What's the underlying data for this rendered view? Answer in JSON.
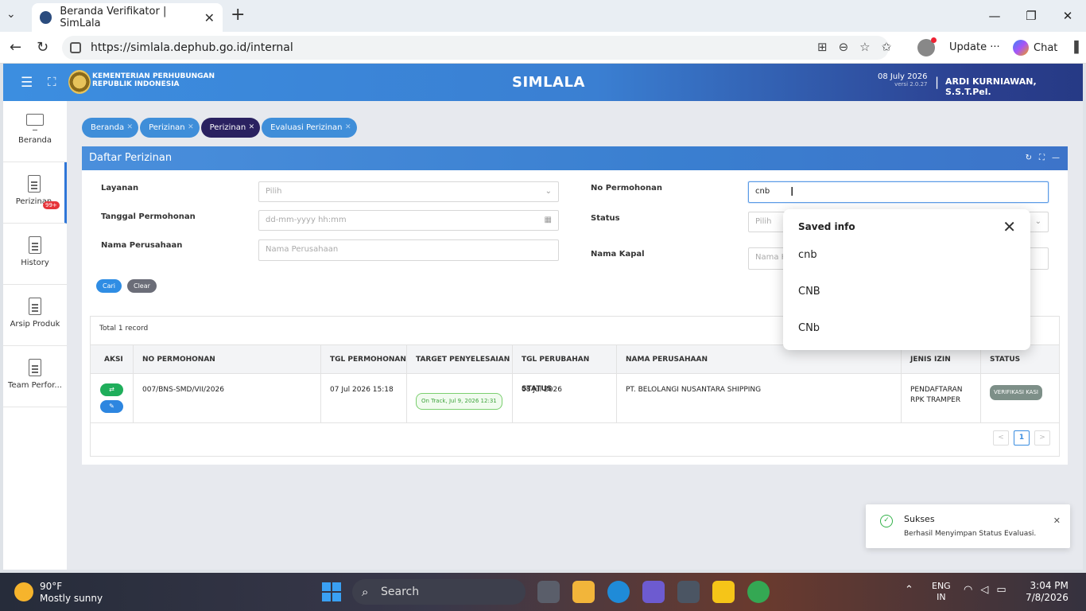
{
  "browser": {
    "tab_title": "Beranda Verifikator | SimLala",
    "url": "https://simlala.dephub.go.id/internal",
    "update_label": "Update",
    "chat_label": "Chat"
  },
  "header": {
    "ministry_line1": "KEMENTERIAN PERHUBUNGAN",
    "ministry_line2": "REPUBLIK INDONESIA",
    "app_title": "SIMLALA",
    "date": "08 July 2026",
    "version": "versi 2.0.27",
    "user": "ARDI KURNIAWAN, S.S.T.Pel."
  },
  "sidebar": {
    "items": [
      {
        "label": "Beranda"
      },
      {
        "label": "Perizinan",
        "badge": "99+"
      },
      {
        "label": "History"
      },
      {
        "label": "Arsip Produk"
      },
      {
        "label": "Team Perfor..."
      }
    ]
  },
  "crumbs": [
    "Beranda",
    "Perizinan",
    "Perizinan",
    "Evaluasi Perizinan"
  ],
  "panel": {
    "title": "Daftar Perizinan",
    "filters": {
      "layanan_label": "Layanan",
      "layanan_value": "Pilih",
      "tanggal_label": "Tanggal Permohonan",
      "tanggal_placeholder": "dd-mm-yyyy hh:mm",
      "nama_perusahaan_label": "Nama Perusahaan",
      "nama_perusahaan_placeholder": "Nama Perusahaan",
      "no_permohonan_label": "No Permohonan",
      "no_permohonan_value": "cnb",
      "status_label": "Status",
      "status_value": "Pilih",
      "nama_kapal_label": "Nama Kapal",
      "nama_kapal_placeholder": "Nama K"
    },
    "buttons": {
      "cari": "Cari",
      "clear": "Clear"
    }
  },
  "table": {
    "total": "Total 1 record",
    "headers": [
      "AKSI",
      "NO PERMOHONAN",
      "TGL PERMOHONAN",
      "TARGET PENYELESAIAN",
      "TGL PERUBAHAN STATUS",
      "NAMA PERUSAHAAN",
      "JENIS IZIN",
      "STATUS"
    ],
    "rows": [
      {
        "no_permohonan": "007/BNS-SMD/VII/2026",
        "tgl_permohonan": "07 Jul 2026 15:18",
        "target": "On Track, Jul 9, 2026 12:31",
        "tgl_perubahan": "08 Jul 2026",
        "nama_perusahaan": "PT. BELOLANGI NUSANTARA SHIPPING",
        "jenis_izin_1": "PENDAFTARAN",
        "jenis_izin_2": "RPK TRAMPER",
        "status": "VERIFIKASI KASI"
      }
    ],
    "page": "1"
  },
  "autofill": {
    "title": "Saved info",
    "items": [
      "cnb",
      "CNB",
      "CNb"
    ]
  },
  "toast": {
    "title": "Sukses",
    "message": "Berhasil Menyimpan Status Evaluasi."
  },
  "taskbar": {
    "temp": "90°F",
    "weather": "Mostly sunny",
    "search": "Search",
    "lang1": "ENG",
    "lang2": "IN",
    "time": "3:04 PM",
    "date": "7/8/2026"
  }
}
